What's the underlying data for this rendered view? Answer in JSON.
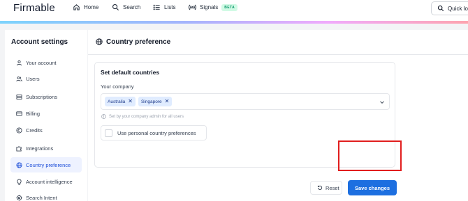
{
  "app": {
    "logo": "Firmable"
  },
  "nav": {
    "home": "Home",
    "search": "Search",
    "lists": "Lists",
    "signals": "Signals",
    "signals_badge": "BETA",
    "quick_lookup": "Quick loo"
  },
  "sidebar": {
    "title": "Account settings",
    "items": [
      {
        "label": "Your account",
        "icon": "user-icon"
      },
      {
        "label": "Users",
        "icon": "users-icon"
      },
      {
        "label": "Subscriptions",
        "icon": "stack-icon"
      },
      {
        "label": "Billing",
        "icon": "card-icon"
      },
      {
        "label": "Credits",
        "icon": "coin-icon"
      },
      {
        "label": "Integrations",
        "icon": "puzzle-icon"
      },
      {
        "label": "Country preference",
        "icon": "globe-icon",
        "active": true
      },
      {
        "label": "Account intelligence",
        "icon": "bulb-icon"
      },
      {
        "label": "Search Intent",
        "icon": "target-icon"
      }
    ]
  },
  "main": {
    "title": "Country preference",
    "card": {
      "title": "Set default countries",
      "field_label": "Your company",
      "chips": [
        "Australia",
        "Singapore"
      ],
      "hint": "Set by your company admin for all users",
      "checkbox_label": "Use personal country preferences",
      "checkbox_checked": false
    },
    "reset_label": "Reset",
    "save_label": "Save changes"
  },
  "colors": {
    "accent": "#1d6fe0",
    "highlight": "#e11d1d",
    "active_bg": "#eef2ff"
  }
}
